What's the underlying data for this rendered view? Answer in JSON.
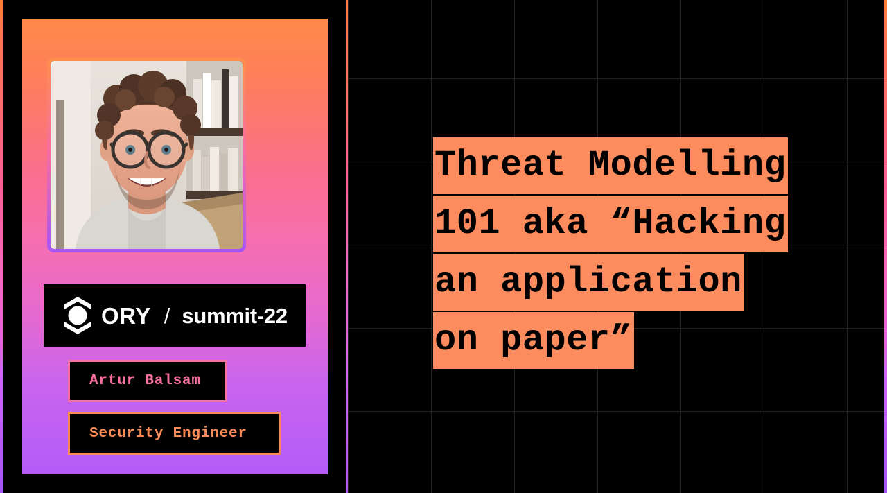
{
  "slide": {
    "background_color": "#000000",
    "accent_orange": "#FC8C5E",
    "accent_pink": "#F7709F",
    "accent_purple": "#B45CF8"
  },
  "speaker_card": {
    "avatar": {
      "alt": "Portrait photo of speaker with curly brown hair and round glasses, smiling, bookshelf in background"
    },
    "logo": {
      "mark_name": "ory-logo-mark",
      "brand": "ORY",
      "separator": "/",
      "event": "summit-22"
    },
    "name": "Artur Balsam",
    "role": "Security Engineer"
  },
  "title": {
    "lines": [
      "Threat Modelling",
      "101 aka “Hacking",
      "an application",
      "on paper”"
    ],
    "full_text": "Threat Modelling 101 aka “Hacking an application on paper”"
  }
}
